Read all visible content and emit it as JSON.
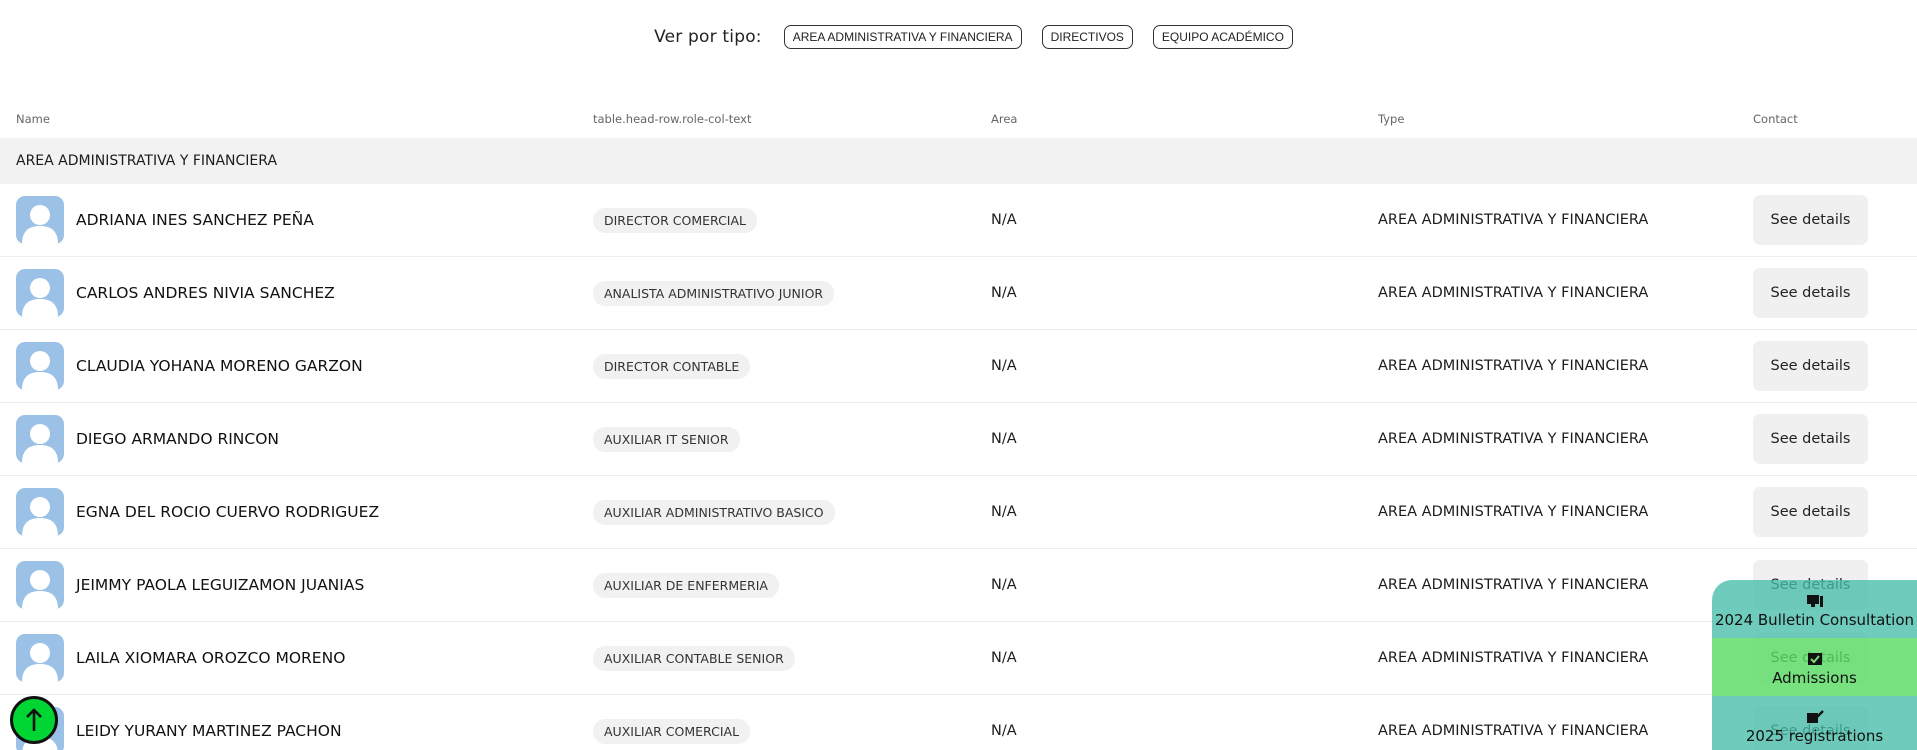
{
  "filters": {
    "label": "Ver por tipo:",
    "chips": [
      "AREA ADMINISTRATIVA Y FINANCIERA",
      "DIRECTIVOS",
      "EQUIPO ACADÉMICO"
    ]
  },
  "table": {
    "headers": {
      "name": "Name",
      "role": "table.head-row.role-col-text",
      "area": "Area",
      "type": "Type",
      "contact": "Contact"
    },
    "group": "AREA ADMINISTRATIVA Y FINANCIERA",
    "rows": [
      {
        "name": "ADRIANA INES SANCHEZ PEÑA",
        "role": "DIRECTOR COMERCIAL",
        "area": "N/A",
        "type": "AREA ADMINISTRATIVA Y FINANCIERA",
        "contact": "See details"
      },
      {
        "name": "CARLOS ANDRES NIVIA SANCHEZ",
        "role": "ANALISTA ADMINISTRATIVO JUNIOR",
        "area": "N/A",
        "type": "AREA ADMINISTRATIVA Y FINANCIERA",
        "contact": "See details"
      },
      {
        "name": "CLAUDIA YOHANA MORENO GARZON",
        "role": "DIRECTOR CONTABLE",
        "area": "N/A",
        "type": "AREA ADMINISTRATIVA Y FINANCIERA",
        "contact": "See details"
      },
      {
        "name": "DIEGO ARMANDO RINCON",
        "role": "AUXILIAR IT SENIOR",
        "area": "N/A",
        "type": "AREA ADMINISTRATIVA Y FINANCIERA",
        "contact": "See details"
      },
      {
        "name": "EGNA DEL ROCIO CUERVO RODRIGUEZ",
        "role": "AUXILIAR ADMINISTRATIVO BASICO",
        "area": "N/A",
        "type": "AREA ADMINISTRATIVA Y FINANCIERA",
        "contact": "See details"
      },
      {
        "name": "JEIMMY PAOLA LEGUIZAMON JUANIAS",
        "role": "AUXILIAR DE ENFERMERIA",
        "area": "N/A",
        "type": "AREA ADMINISTRATIVA Y FINANCIERA",
        "contact": "See details"
      },
      {
        "name": "LAILA XIOMARA OROZCO MORENO",
        "role": "AUXILIAR CONTABLE SENIOR",
        "area": "N/A",
        "type": "AREA ADMINISTRATIVA Y FINANCIERA",
        "contact": "See details"
      },
      {
        "name": "LEIDY YURANY MARTINEZ PACHON",
        "role": "AUXILIAR COMERCIAL",
        "area": "N/A",
        "type": "AREA ADMINISTRATIVA Y FINANCIERA",
        "contact": "See details"
      }
    ]
  },
  "quick_links": [
    {
      "label": "2024 Bulletin Consultation",
      "icon": "computer-icon"
    },
    {
      "label": "Admissions",
      "icon": "checkbox-icon"
    },
    {
      "label": "2025 registrations",
      "icon": "signature-icon"
    }
  ],
  "scroll_top": {
    "icon": "arrow-up-icon"
  }
}
